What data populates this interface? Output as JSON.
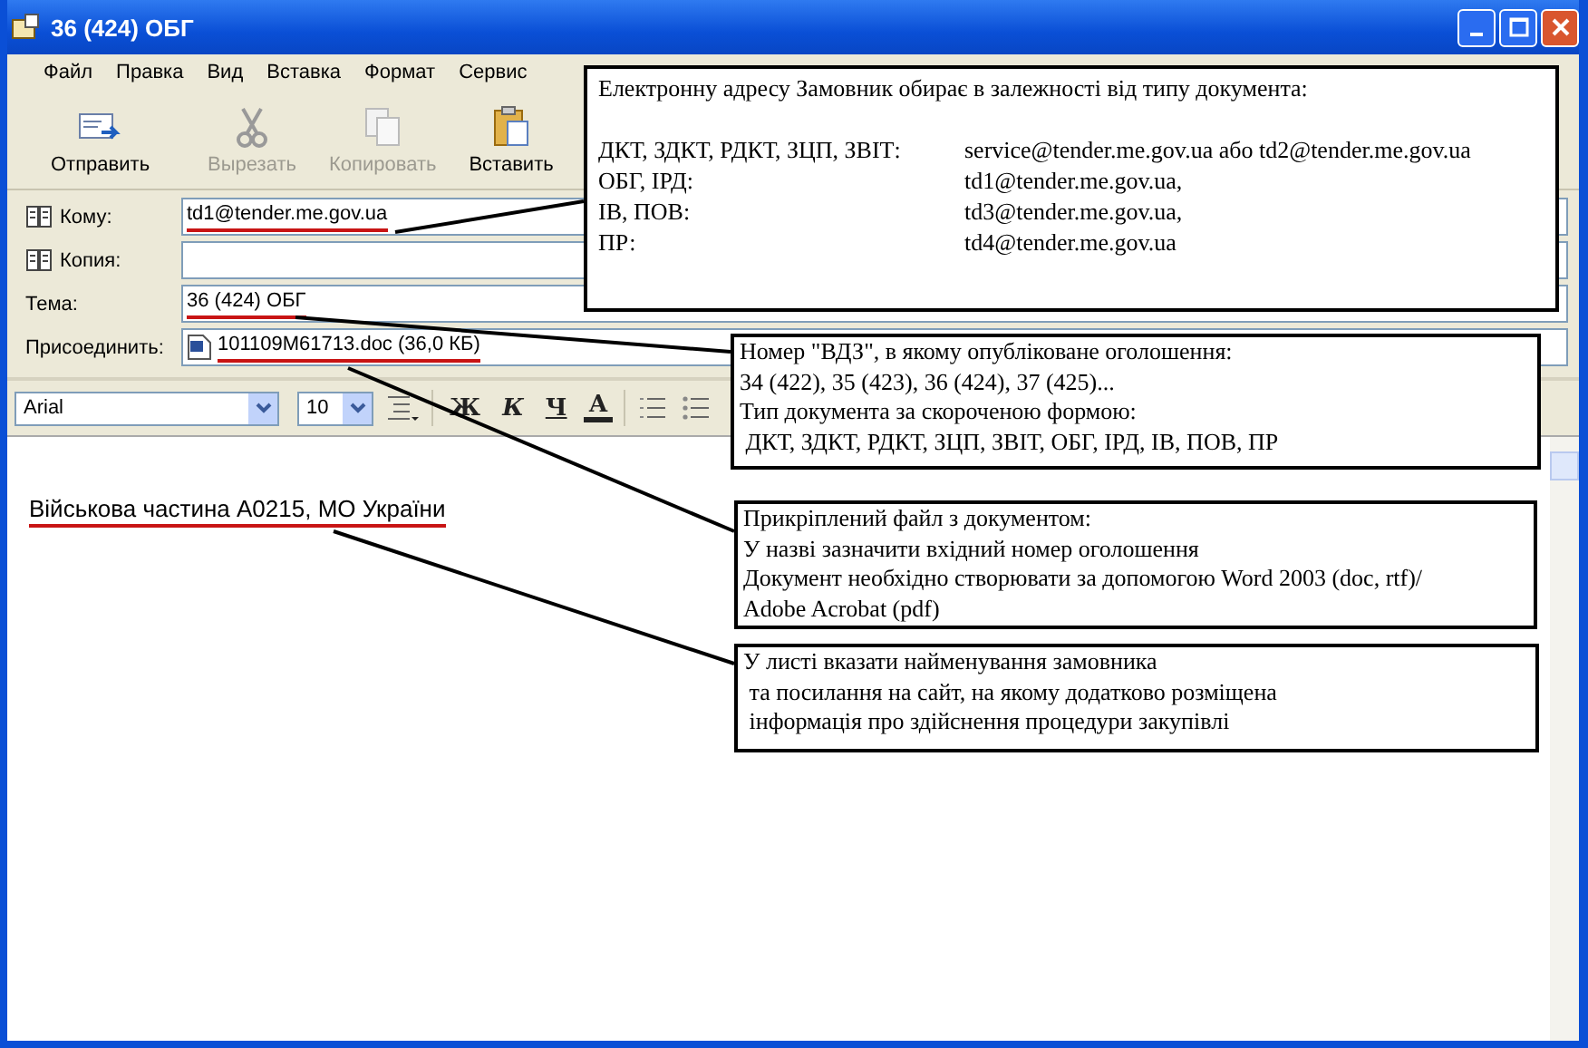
{
  "window": {
    "title": "36 (424) ОБГ"
  },
  "menu": [
    "Файл",
    "Правка",
    "Вид",
    "Вставка",
    "Формат",
    "Сервис"
  ],
  "toolbar": [
    {
      "label": "Отправить",
      "kind": "send",
      "disabled": false
    },
    {
      "label": "Вырезать",
      "kind": "cut",
      "disabled": true
    },
    {
      "label": "Копировать",
      "kind": "copy",
      "disabled": true
    },
    {
      "label": "Вставить",
      "kind": "paste",
      "disabled": false
    }
  ],
  "fields": [
    {
      "label": "Кому:",
      "kind": "address",
      "value": "td1@tender.me.gov.ua",
      "marked": true
    },
    {
      "label": "Копия:",
      "kind": "address"
    },
    {
      "label": "Тема:",
      "kind": "plain",
      "value": "36 (424) ОБГ",
      "marked": true
    },
    {
      "label": "Присоединить:",
      "kind": "attachment",
      "value": "101109M61713.doc (36,0 КБ)",
      "marked": true
    }
  ],
  "format_bar": {
    "font": "Arial",
    "size": "10",
    "styles": [
      {
        "label": "Ж",
        "kind": "bold"
      },
      {
        "label": "К",
        "kind": "italic"
      },
      {
        "label": "Ч",
        "kind": "underline"
      },
      {
        "label": "А",
        "kind": "color"
      }
    ]
  },
  "body": {
    "text": "Військова частина А0215, МО України",
    "marked": true
  },
  "address_note": {
    "heading": "Електронну адресу Замовник обирає в залежності від типу документа:",
    "rows": [
      {
        "label": "ДКТ, ЗДКТ, РДКТ, ЗЦП, ЗВІТ:",
        "address": "service@tender.me.gov.ua або td2@tender.me.gov.ua"
      },
      {
        "label": "ОБГ, ІРД:",
        "address": "td1@tender.me.gov.ua,"
      },
      {
        "label": "ІВ, ПОВ:",
        "address": "td3@tender.me.gov.ua,"
      },
      {
        "label": "ПР:",
        "address": "td4@tender.me.gov.ua"
      }
    ]
  },
  "callouts": [
    {
      "lines": [
        "Номер \"ВДЗ\", в якому опубліковане оголошення:",
        "34 (422), 35 (423), 36 (424), 37 (425)...",
        "Тип документа за скороченою формою:",
        " ДКТ, ЗДКТ, РДКТ, ЗЦП, ЗВІТ, ОБГ, ІРД, ІВ, ПОВ, ПР"
      ]
    },
    {
      "lines": [
        "Прикріплений файл з документом:",
        "У назві зазначити вхідний номер оголошення",
        "Документ необхідно створювати за допомогою Word 2003 (doc, rtf)/",
        "Adobe Acrobat (pdf)"
      ]
    },
    {
      "lines": [
        "У листі вказати найменування замовника",
        " та посилання на сайт, на якому додатково розміщена",
        " інформація про здійснення процедури закупівлі"
      ]
    }
  ]
}
